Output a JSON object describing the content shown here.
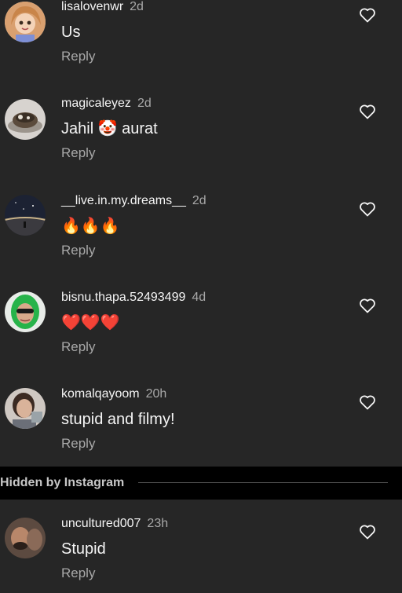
{
  "comments": [
    {
      "username": "lisalovenwr",
      "time": "2d",
      "text": "Us",
      "reply": "Reply"
    },
    {
      "username": "magicaleyez",
      "time": "2d",
      "text": "Jahil 🤡 aurat",
      "reply": "Reply"
    },
    {
      "username": "__live.in.my.dreams__",
      "time": "2d",
      "text": "🔥🔥🔥",
      "reply": "Reply"
    },
    {
      "username": "bisnu.thapa.52493499",
      "time": "4d",
      "text": "❤️❤️❤️",
      "reply": "Reply"
    },
    {
      "username": "komalqayoom",
      "time": "20h",
      "text": "stupid and filmy!",
      "reply": "Reply"
    }
  ],
  "hidden_section": {
    "label": "Hidden by Instagram",
    "comments": [
      {
        "username": "uncultured007",
        "time": "23h",
        "text": "Stupid",
        "reply": "Reply"
      }
    ]
  },
  "icons": {
    "like": "heart-outline-icon",
    "avatar": "avatar"
  },
  "colors": {
    "background": "#262626",
    "hidden_bar": "#000000",
    "secondary_text": "#a8a8a8"
  }
}
